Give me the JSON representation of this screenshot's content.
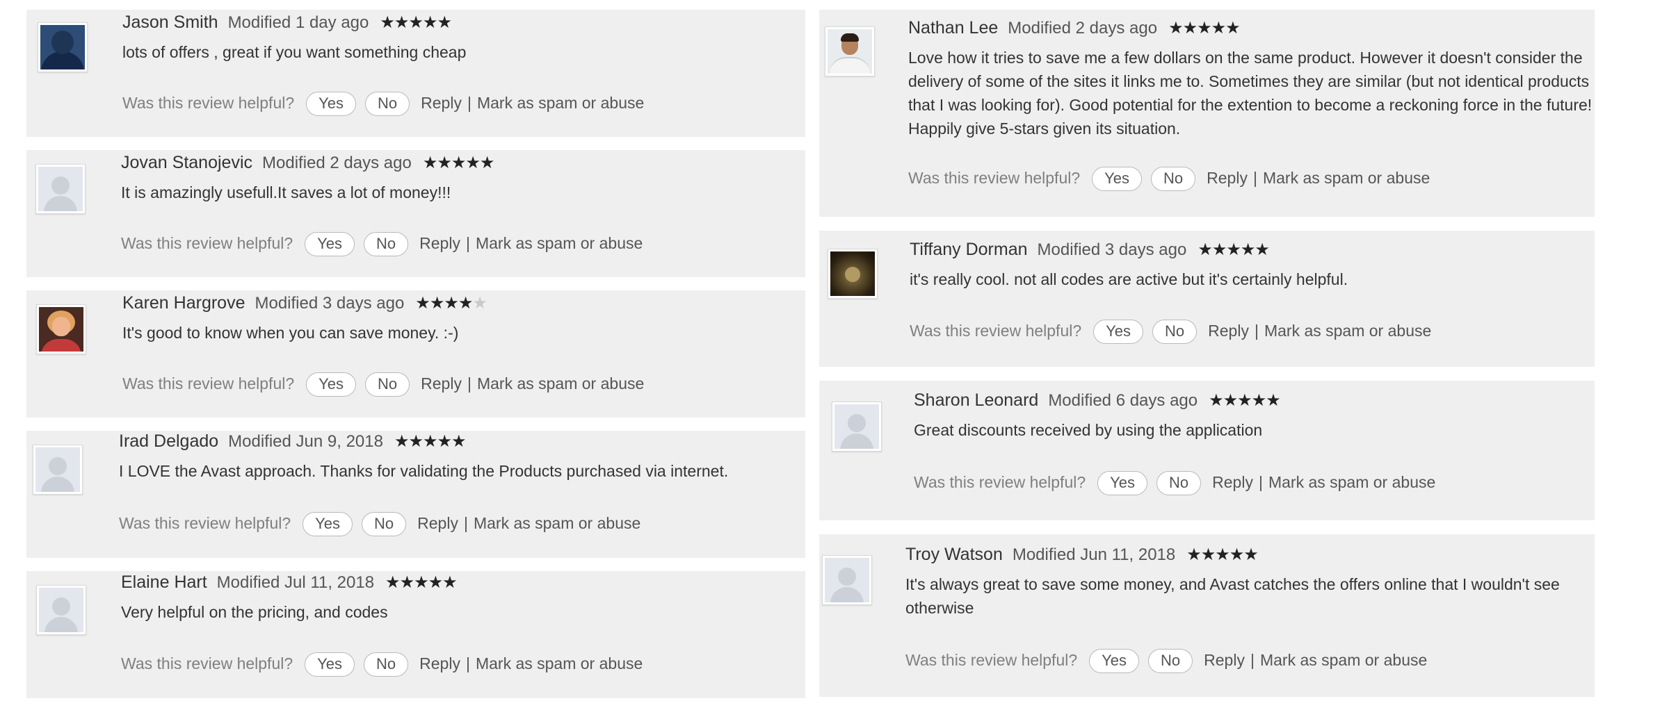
{
  "helpful_prompt": "Was this review helpful?",
  "yes_label": "Yes",
  "no_label": "No",
  "reply_label": "Reply",
  "separator": "|",
  "spam_label": "Mark as spam or abuse",
  "star_char": "★",
  "reviews_left": [
    {
      "author": "Jason Smith",
      "modified": "Modified 1 day ago",
      "rating": 5,
      "text": "lots of offers , great if you want something cheap",
      "avatar": "photo-navy"
    },
    {
      "author": "Jovan Stanojevic",
      "modified": "Modified 2 days ago",
      "rating": 5,
      "text": "It is amazingly usefull.It saves a lot of money!!!",
      "avatar": "default"
    },
    {
      "author": "Karen Hargrove",
      "modified": "Modified 3 days ago",
      "rating": 4,
      "text": "It's good to know when you can save money. :-)",
      "avatar": "photo-woman"
    },
    {
      "author": "Irad Delgado",
      "modified": "Modified Jun 9, 2018",
      "rating": 5,
      "text": "I LOVE the Avast approach. Thanks for validating the Products purchased via internet.",
      "avatar": "default"
    },
    {
      "author": "Elaine Hart",
      "modified": "Modified Jul 11, 2018",
      "rating": 5,
      "text": "Very helpful on the pricing, and codes",
      "avatar": "default"
    }
  ],
  "reviews_right": [
    {
      "author": "Nathan Lee",
      "modified": "Modified 2 days ago",
      "rating": 5,
      "text": "Love how it tries to save me a few dollars on the same product. However it doesn't consider the delivery of some of the sites it links me to. Sometimes they are similar (but not identical products that I was looking for). Good potential for the extention to become a reckoning force in the future! Happily give 5-stars given its situation.",
      "avatar": "photo-man"
    },
    {
      "author": "Tiffany Dorman",
      "modified": "Modified 3 days ago",
      "rating": 5,
      "text": "it's really cool. not all codes are active but it's certainly helpful.",
      "avatar": "photo-dark"
    },
    {
      "author": "Sharon Leonard",
      "modified": "Modified 6 days ago",
      "rating": 5,
      "text": "Great discounts received by using the application",
      "avatar": "default"
    },
    {
      "author": "Troy Watson",
      "modified": "Modified Jun 11, 2018",
      "rating": 5,
      "text": "It's always great to save some money, and Avast catches the offers online that I wouldn't see otherwise",
      "avatar": "default"
    }
  ]
}
